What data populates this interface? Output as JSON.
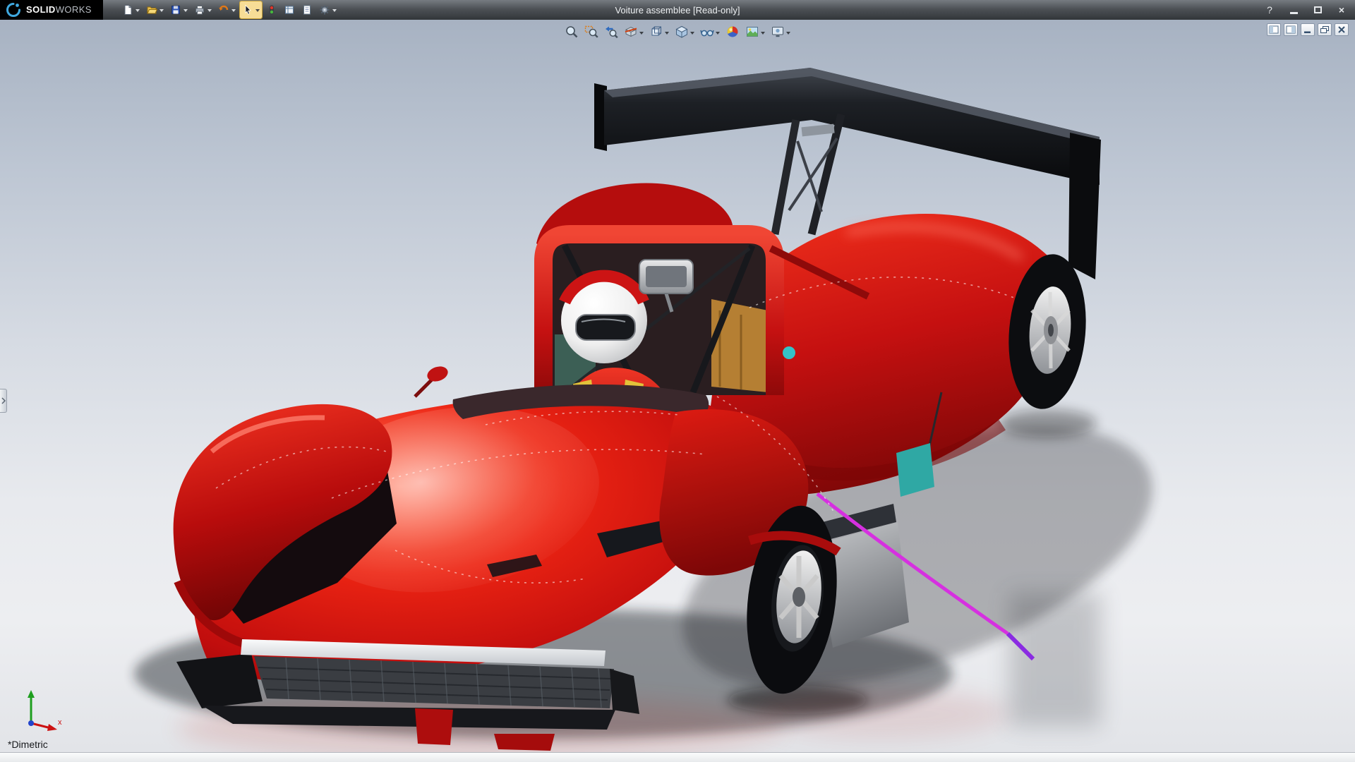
{
  "titlebar": {
    "logo": {
      "brand_bold": "SOLID",
      "brand_light": "WORKS"
    },
    "title": "Voiture assemblee [Read-only]",
    "controls": {
      "help": "?",
      "close": "×"
    },
    "icons": [
      "dassault-systemes-logo-icon",
      "minimize-icon",
      "maximize-icon",
      "close-icon"
    ]
  },
  "main_toolbar": {
    "items": [
      {
        "name": "new-document",
        "dropdown": true
      },
      {
        "name": "open-document",
        "dropdown": true
      },
      {
        "name": "save",
        "dropdown": true
      },
      {
        "name": "print",
        "dropdown": true
      },
      {
        "name": "undo",
        "dropdown": true
      },
      {
        "name": "select-tool",
        "dropdown": true,
        "active": true
      },
      {
        "name": "selection-filter",
        "dropdown": false
      },
      {
        "name": "rebuild",
        "dropdown": false
      },
      {
        "name": "file-properties",
        "dropdown": false
      },
      {
        "name": "options",
        "dropdown": true
      }
    ]
  },
  "heads_up_toolbar": {
    "items": [
      {
        "name": "zoom-to-fit",
        "dropdown": false
      },
      {
        "name": "zoom-to-area",
        "dropdown": false
      },
      {
        "name": "previous-view",
        "dropdown": false
      },
      {
        "name": "section-view",
        "dropdown": true
      },
      {
        "name": "view-orientation",
        "dropdown": true
      },
      {
        "name": "display-style",
        "dropdown": true
      },
      {
        "name": "hide-show-items",
        "dropdown": true
      },
      {
        "name": "edit-appearance",
        "dropdown": false
      },
      {
        "name": "apply-scene",
        "dropdown": true
      },
      {
        "name": "view-settings",
        "dropdown": true
      }
    ]
  },
  "doc_window_controls": [
    "toggle-left-pane",
    "toggle-task-pane",
    "minimize-document",
    "restore-document",
    "close-document"
  ],
  "viewport": {
    "view_orientation_label": "*Dimetric",
    "triad": {
      "x_label": "x"
    }
  },
  "model": {
    "subject": "red prototype race car assembly with driver and black rear wing",
    "body_color": "#c51010",
    "wing_color": "#101114",
    "accent_magenta": "#d630e0",
    "accent_teal": "#2fa8a4",
    "background_top": "#a7b2c2",
    "background_bottom": "#e2e4e8"
  },
  "status_bar": {
    "text": ""
  }
}
